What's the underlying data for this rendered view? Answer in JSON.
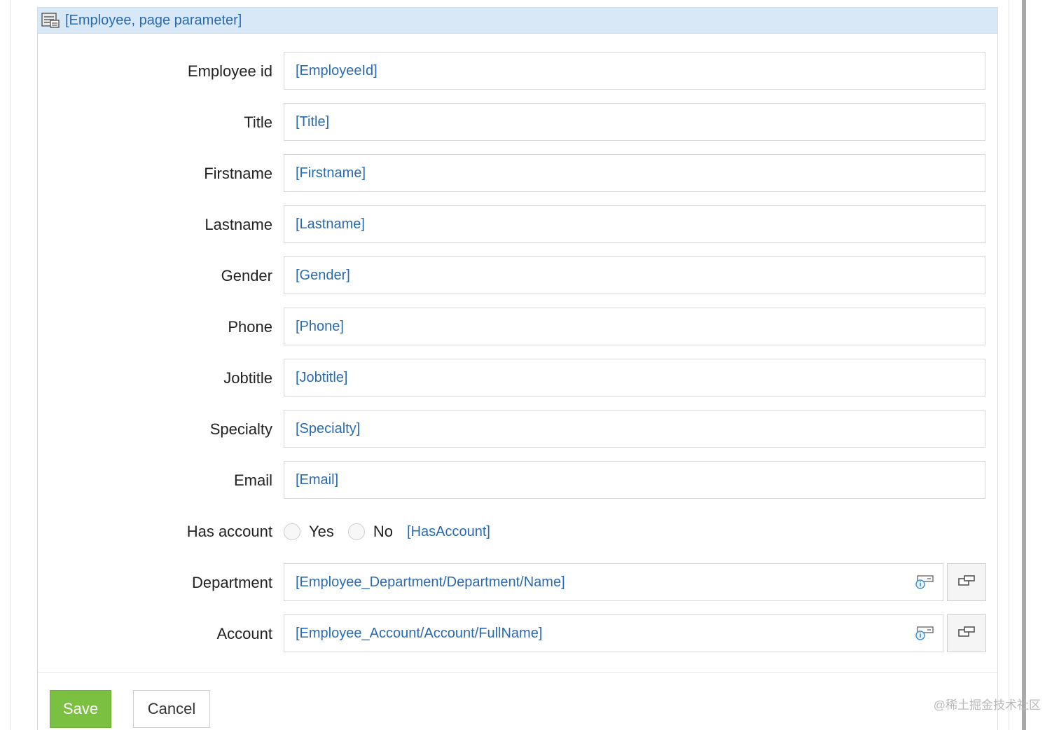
{
  "header": {
    "title": "[Employee, page parameter]",
    "icon": "form-table-icon"
  },
  "fields": [
    {
      "label": "Employee id",
      "value": "[EmployeeId]"
    },
    {
      "label": "Title",
      "value": "[Title]"
    },
    {
      "label": "Firstname",
      "value": "[Firstname]"
    },
    {
      "label": "Lastname",
      "value": "[Lastname]"
    },
    {
      "label": "Gender",
      "value": "[Gender]"
    },
    {
      "label": "Phone",
      "value": "[Phone]"
    },
    {
      "label": "Jobtitle",
      "value": "[Jobtitle]"
    },
    {
      "label": "Specialty",
      "value": "[Specialty]"
    },
    {
      "label": "Email",
      "value": "[Email]"
    }
  ],
  "has_account": {
    "label": "Has account",
    "option_yes": "Yes",
    "option_no": "No",
    "binding": "[HasAccount]"
  },
  "department": {
    "label": "Department",
    "value": "[Employee_Department/Department/Name]",
    "lookup_icon": "lookup-info-icon",
    "button_icon": "open-form-icon"
  },
  "account": {
    "label": "Account",
    "value": "[Employee_Account/Account/FullName]",
    "lookup_icon": "lookup-info-icon",
    "button_icon": "open-form-icon"
  },
  "actions": {
    "save_label": "Save",
    "cancel_label": "Cancel"
  },
  "watermark": "@稀土掘金技术社区",
  "colors": {
    "header_bg": "#d9e8f6",
    "bound_text": "#2a6bb0",
    "save_bg": "#7cc042"
  }
}
